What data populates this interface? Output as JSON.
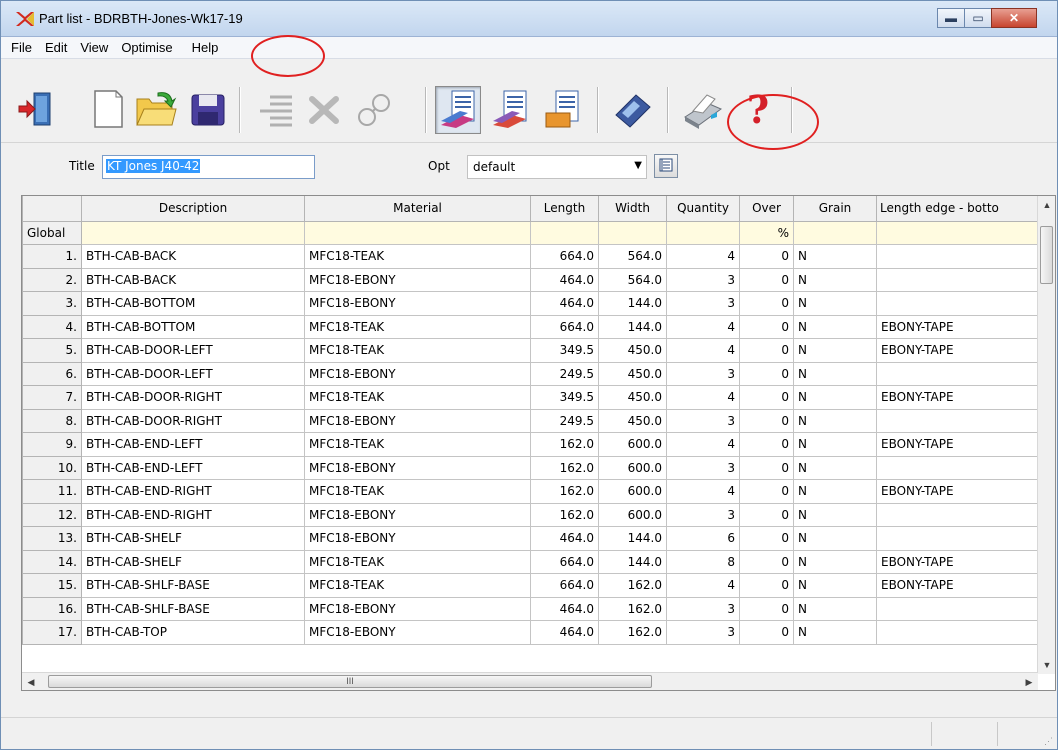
{
  "window": {
    "title": "Part list - BDRBTH-Jones-Wk17-19",
    "minimize_glyph": "▬",
    "maximize_glyph": "▭",
    "close_glyph": "✕"
  },
  "menu": {
    "items": [
      "File",
      "Edit",
      "View",
      "Optimise",
      "Help"
    ]
  },
  "toolbar": {
    "buttons": [
      {
        "icon": "exit-door-icon",
        "pressed": false
      },
      {
        "icon": "new-document-icon",
        "pressed": false
      },
      {
        "icon": "open-folder-icon",
        "pressed": false
      },
      {
        "icon": "save-disk-icon",
        "pressed": false
      },
      {
        "icon": "list-lines-icon",
        "pressed": false
      },
      {
        "icon": "delete-x-icon",
        "pressed": false
      },
      {
        "icon": "link-icon",
        "pressed": false
      },
      {
        "icon": "part-list-icon",
        "pressed": true
      },
      {
        "icon": "board-list-icon",
        "pressed": false
      },
      {
        "icon": "edging-list-icon",
        "pressed": false
      },
      {
        "icon": "calculator-icon",
        "pressed": false
      },
      {
        "icon": "printer-icon",
        "pressed": false
      },
      {
        "icon": "help-question-icon",
        "pressed": false
      }
    ]
  },
  "form": {
    "title_label": "Title",
    "title_value": "KT Jones J40-42",
    "opt_label": "Opt",
    "opt_value": "default"
  },
  "grid": {
    "columns": [
      "",
      "Description",
      "Material",
      "Length",
      "Width",
      "Quantity",
      "Over",
      "Grain",
      "Length edge - botto"
    ],
    "global_row": {
      "label": "Global",
      "over": "%"
    },
    "rows": [
      [
        "1.",
        "BTH-CAB-BACK",
        "MFC18-TEAK",
        "664.0",
        "564.0",
        "4",
        "0",
        "N",
        ""
      ],
      [
        "2.",
        "BTH-CAB-BACK",
        "MFC18-EBONY",
        "464.0",
        "564.0",
        "3",
        "0",
        "N",
        ""
      ],
      [
        "3.",
        "BTH-CAB-BOTTOM",
        "MFC18-EBONY",
        "464.0",
        "144.0",
        "3",
        "0",
        "N",
        ""
      ],
      [
        "4.",
        "BTH-CAB-BOTTOM",
        "MFC18-TEAK",
        "664.0",
        "144.0",
        "4",
        "0",
        "N",
        "EBONY-TAPE"
      ],
      [
        "5.",
        "BTH-CAB-DOOR-LEFT",
        "MFC18-TEAK",
        "349.5",
        "450.0",
        "4",
        "0",
        "N",
        "EBONY-TAPE"
      ],
      [
        "6.",
        "BTH-CAB-DOOR-LEFT",
        "MFC18-EBONY",
        "249.5",
        "450.0",
        "3",
        "0",
        "N",
        ""
      ],
      [
        "7.",
        "BTH-CAB-DOOR-RIGHT",
        "MFC18-TEAK",
        "349.5",
        "450.0",
        "4",
        "0",
        "N",
        "EBONY-TAPE"
      ],
      [
        "8.",
        "BTH-CAB-DOOR-RIGHT",
        "MFC18-EBONY",
        "249.5",
        "450.0",
        "3",
        "0",
        "N",
        ""
      ],
      [
        "9.",
        "BTH-CAB-END-LEFT",
        "MFC18-TEAK",
        "162.0",
        "600.0",
        "4",
        "0",
        "N",
        "EBONY-TAPE"
      ],
      [
        "10.",
        "BTH-CAB-END-LEFT",
        "MFC18-EBONY",
        "162.0",
        "600.0",
        "3",
        "0",
        "N",
        ""
      ],
      [
        "11.",
        "BTH-CAB-END-RIGHT",
        "MFC18-TEAK",
        "162.0",
        "600.0",
        "4",
        "0",
        "N",
        "EBONY-TAPE"
      ],
      [
        "12.",
        "BTH-CAB-END-RIGHT",
        "MFC18-EBONY",
        "162.0",
        "600.0",
        "3",
        "0",
        "N",
        ""
      ],
      [
        "13.",
        "BTH-CAB-SHELF",
        "MFC18-EBONY",
        "464.0",
        "144.0",
        "6",
        "0",
        "N",
        ""
      ],
      [
        "14.",
        "BTH-CAB-SHELF",
        "MFC18-TEAK",
        "664.0",
        "144.0",
        "8",
        "0",
        "N",
        "EBONY-TAPE"
      ],
      [
        "15.",
        "BTH-CAB-SHLF-BASE",
        "MFC18-TEAK",
        "664.0",
        "162.0",
        "4",
        "0",
        "N",
        "EBONY-TAPE"
      ],
      [
        "16.",
        "BTH-CAB-SHLF-BASE",
        "MFC18-EBONY",
        "464.0",
        "162.0",
        "3",
        "0",
        "N",
        ""
      ],
      [
        "17.",
        "BTH-CAB-TOP",
        "MFC18-EBONY",
        "464.0",
        "162.0",
        "3",
        "0",
        "N",
        ""
      ]
    ]
  },
  "scrollbars": {
    "up": "▲",
    "down": "▼",
    "left": "◀",
    "right": "▶",
    "grip": "III"
  },
  "colors": {
    "highlight_circle": "#e02020",
    "global_row_bg": "#fffbe0",
    "selection": "#3399ff"
  }
}
